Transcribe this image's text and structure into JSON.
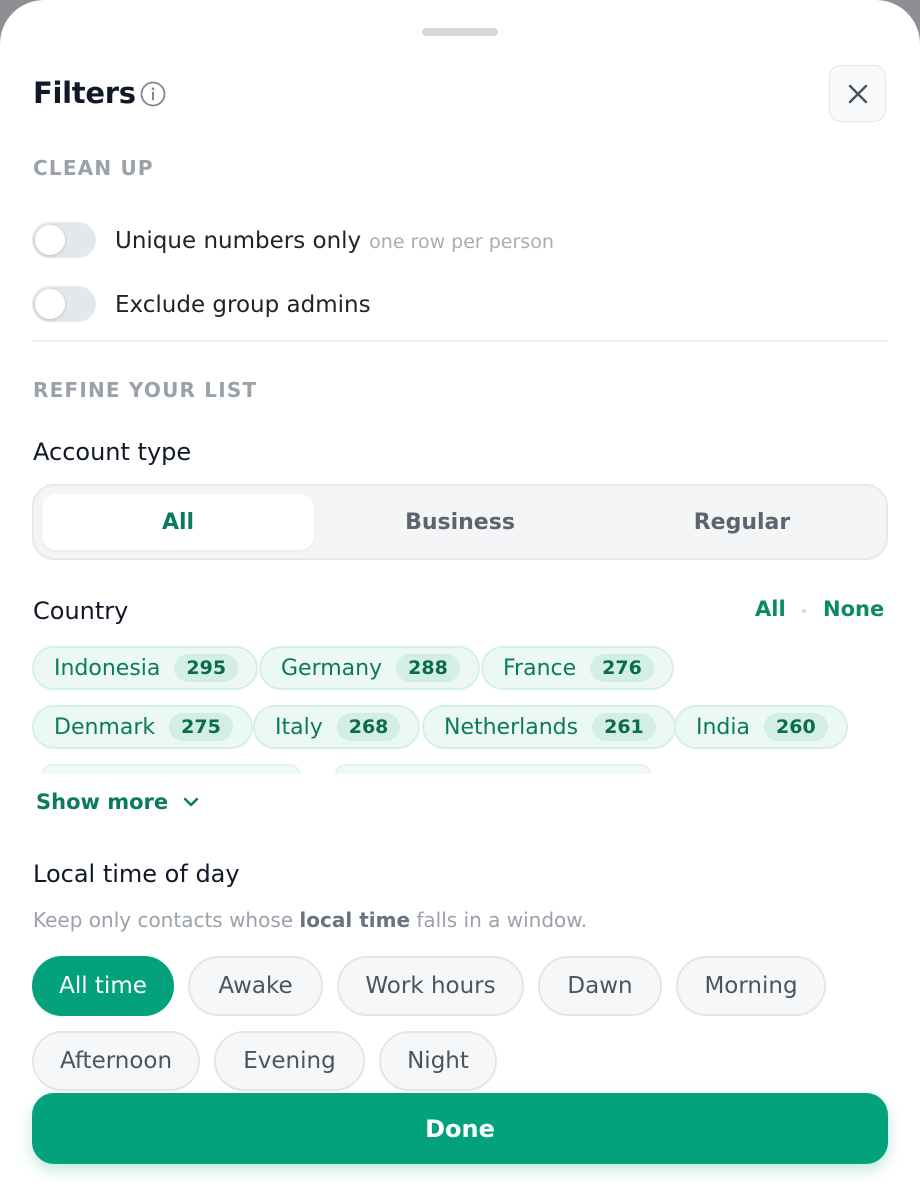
{
  "header": {
    "title": "Filters",
    "info_icon": "info-icon",
    "close_icon": "close-icon"
  },
  "cleanup": {
    "section_label": "CLEAN UP",
    "toggles": [
      {
        "label": "Unique numbers only",
        "hint": "one row per person",
        "on": false
      },
      {
        "label": "Exclude group admins",
        "hint": "",
        "on": false
      }
    ]
  },
  "refine": {
    "section_label": "REFINE YOUR LIST",
    "account_type": {
      "title": "Account type",
      "options": [
        "All",
        "Business",
        "Regular"
      ],
      "selected": "All"
    },
    "country": {
      "title": "Country",
      "select_all": "All",
      "select_none": "None",
      "chips": [
        {
          "name": "Indonesia",
          "count": "295"
        },
        {
          "name": "Germany",
          "count": "288"
        },
        {
          "name": "France",
          "count": "276"
        },
        {
          "name": "Denmark",
          "count": "275"
        },
        {
          "name": "Italy",
          "count": "268"
        },
        {
          "name": "Netherlands",
          "count": "261"
        },
        {
          "name": "India",
          "count": "260"
        }
      ],
      "show_more": "Show more"
    },
    "time_of_day": {
      "title": "Local time of day",
      "description_before": "Keep only contacts whose ",
      "description_bold": "local time",
      "description_after": " falls in a window.",
      "options": [
        "All time",
        "Awake",
        "Work hours",
        "Dawn",
        "Morning",
        "Afternoon",
        "Evening",
        "Night"
      ],
      "selected": "All time"
    }
  },
  "footer": {
    "done_label": "Done"
  },
  "colors": {
    "accent": "#03a27c",
    "accent_text": "#0b7a5e",
    "chip_bg": "#ecf9f3",
    "muted": "#9aa1a9"
  }
}
